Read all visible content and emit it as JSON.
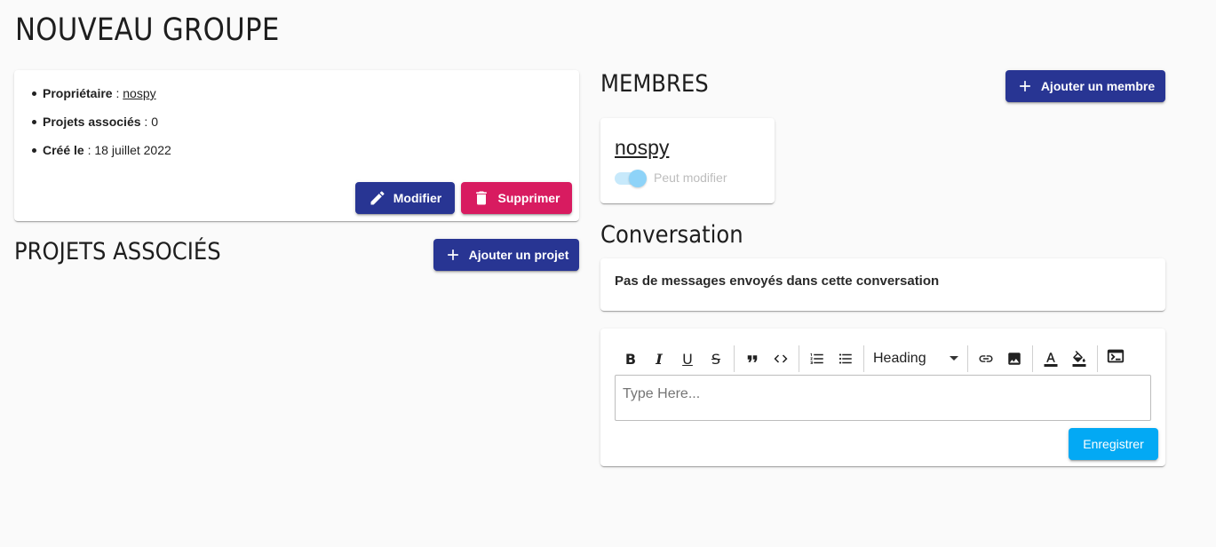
{
  "page": {
    "title": "NOUVEAU GROUPE"
  },
  "info": {
    "owner_label": "Propriétaire",
    "owner_value": "nospy",
    "projects_label": "Projets associés",
    "projects_value": "0",
    "created_label": "Créé le",
    "created_value": "18 juillet 2022",
    "separator": " : ",
    "edit_button": "Modifier",
    "delete_button": "Supprimer"
  },
  "projects": {
    "title": "PROJETS ASSOCIÉS",
    "add_button": "Ajouter un projet"
  },
  "members": {
    "title": "MEMBRES",
    "add_button": "Ajouter un membre",
    "items": [
      {
        "name": "nospy",
        "permission_label": "Peut modifier",
        "can_edit": true
      }
    ]
  },
  "conversation": {
    "title": "Conversation",
    "empty_message": "Pas de messages envoyés dans cette conversation"
  },
  "editor": {
    "heading_select": "Heading",
    "placeholder": "Type Here...",
    "save_button": "Enregistrer",
    "toolbar_icons": [
      "bold-icon",
      "italic-icon",
      "underline-icon",
      "strikethrough-icon",
      "quote-icon",
      "code-icon",
      "ordered-list-icon",
      "bullet-list-icon",
      "link-icon",
      "image-icon",
      "text-color-icon",
      "fill-color-icon",
      "terminal-icon"
    ]
  },
  "colors": {
    "primary": "#283593",
    "danger": "#d81b60",
    "info": "#03a9f4",
    "background": "#fafafa"
  }
}
